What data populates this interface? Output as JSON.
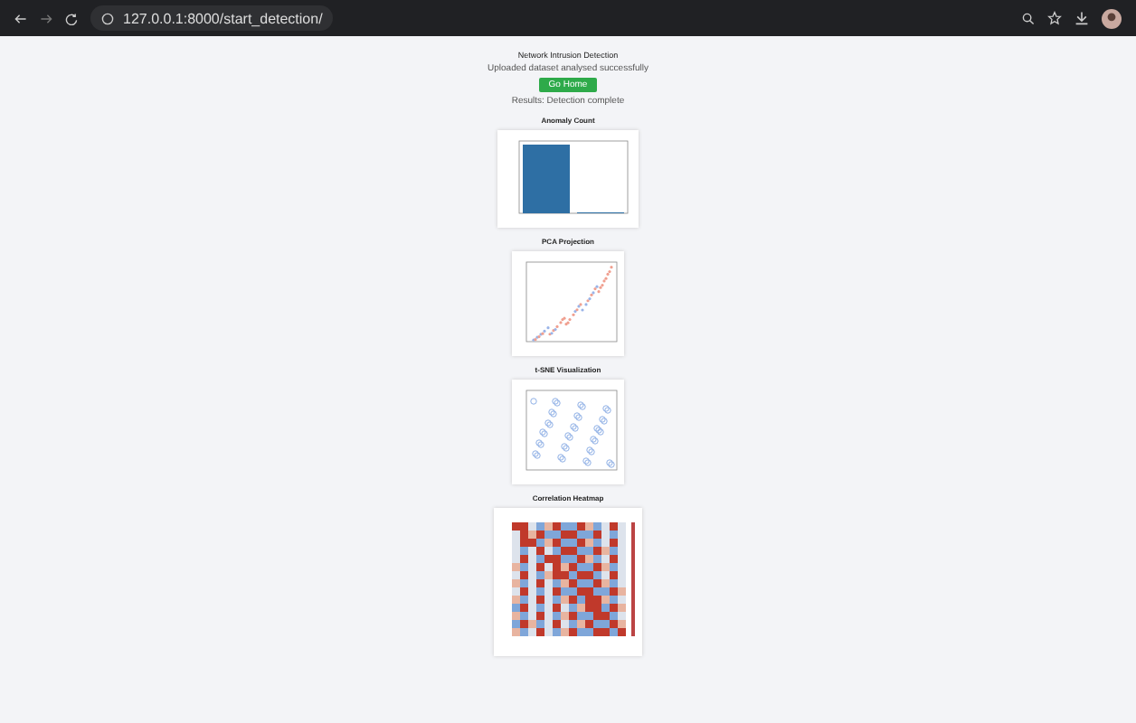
{
  "browser": {
    "url": "127.0.0.1:8000/start_detection/"
  },
  "page": {
    "title": "Network Intrusion Detection",
    "subtitle": "Uploaded dataset analysed successfully",
    "button": "Go Home",
    "status": "Results: Detection complete"
  },
  "sections": [
    {
      "title": "Anomaly Count",
      "kind": "bar"
    },
    {
      "title": "PCA Projection",
      "kind": "scatter"
    },
    {
      "title": "t-SNE Visualization",
      "kind": "cluster"
    },
    {
      "title": "Correlation Heatmap",
      "kind": "heatmap"
    }
  ]
}
